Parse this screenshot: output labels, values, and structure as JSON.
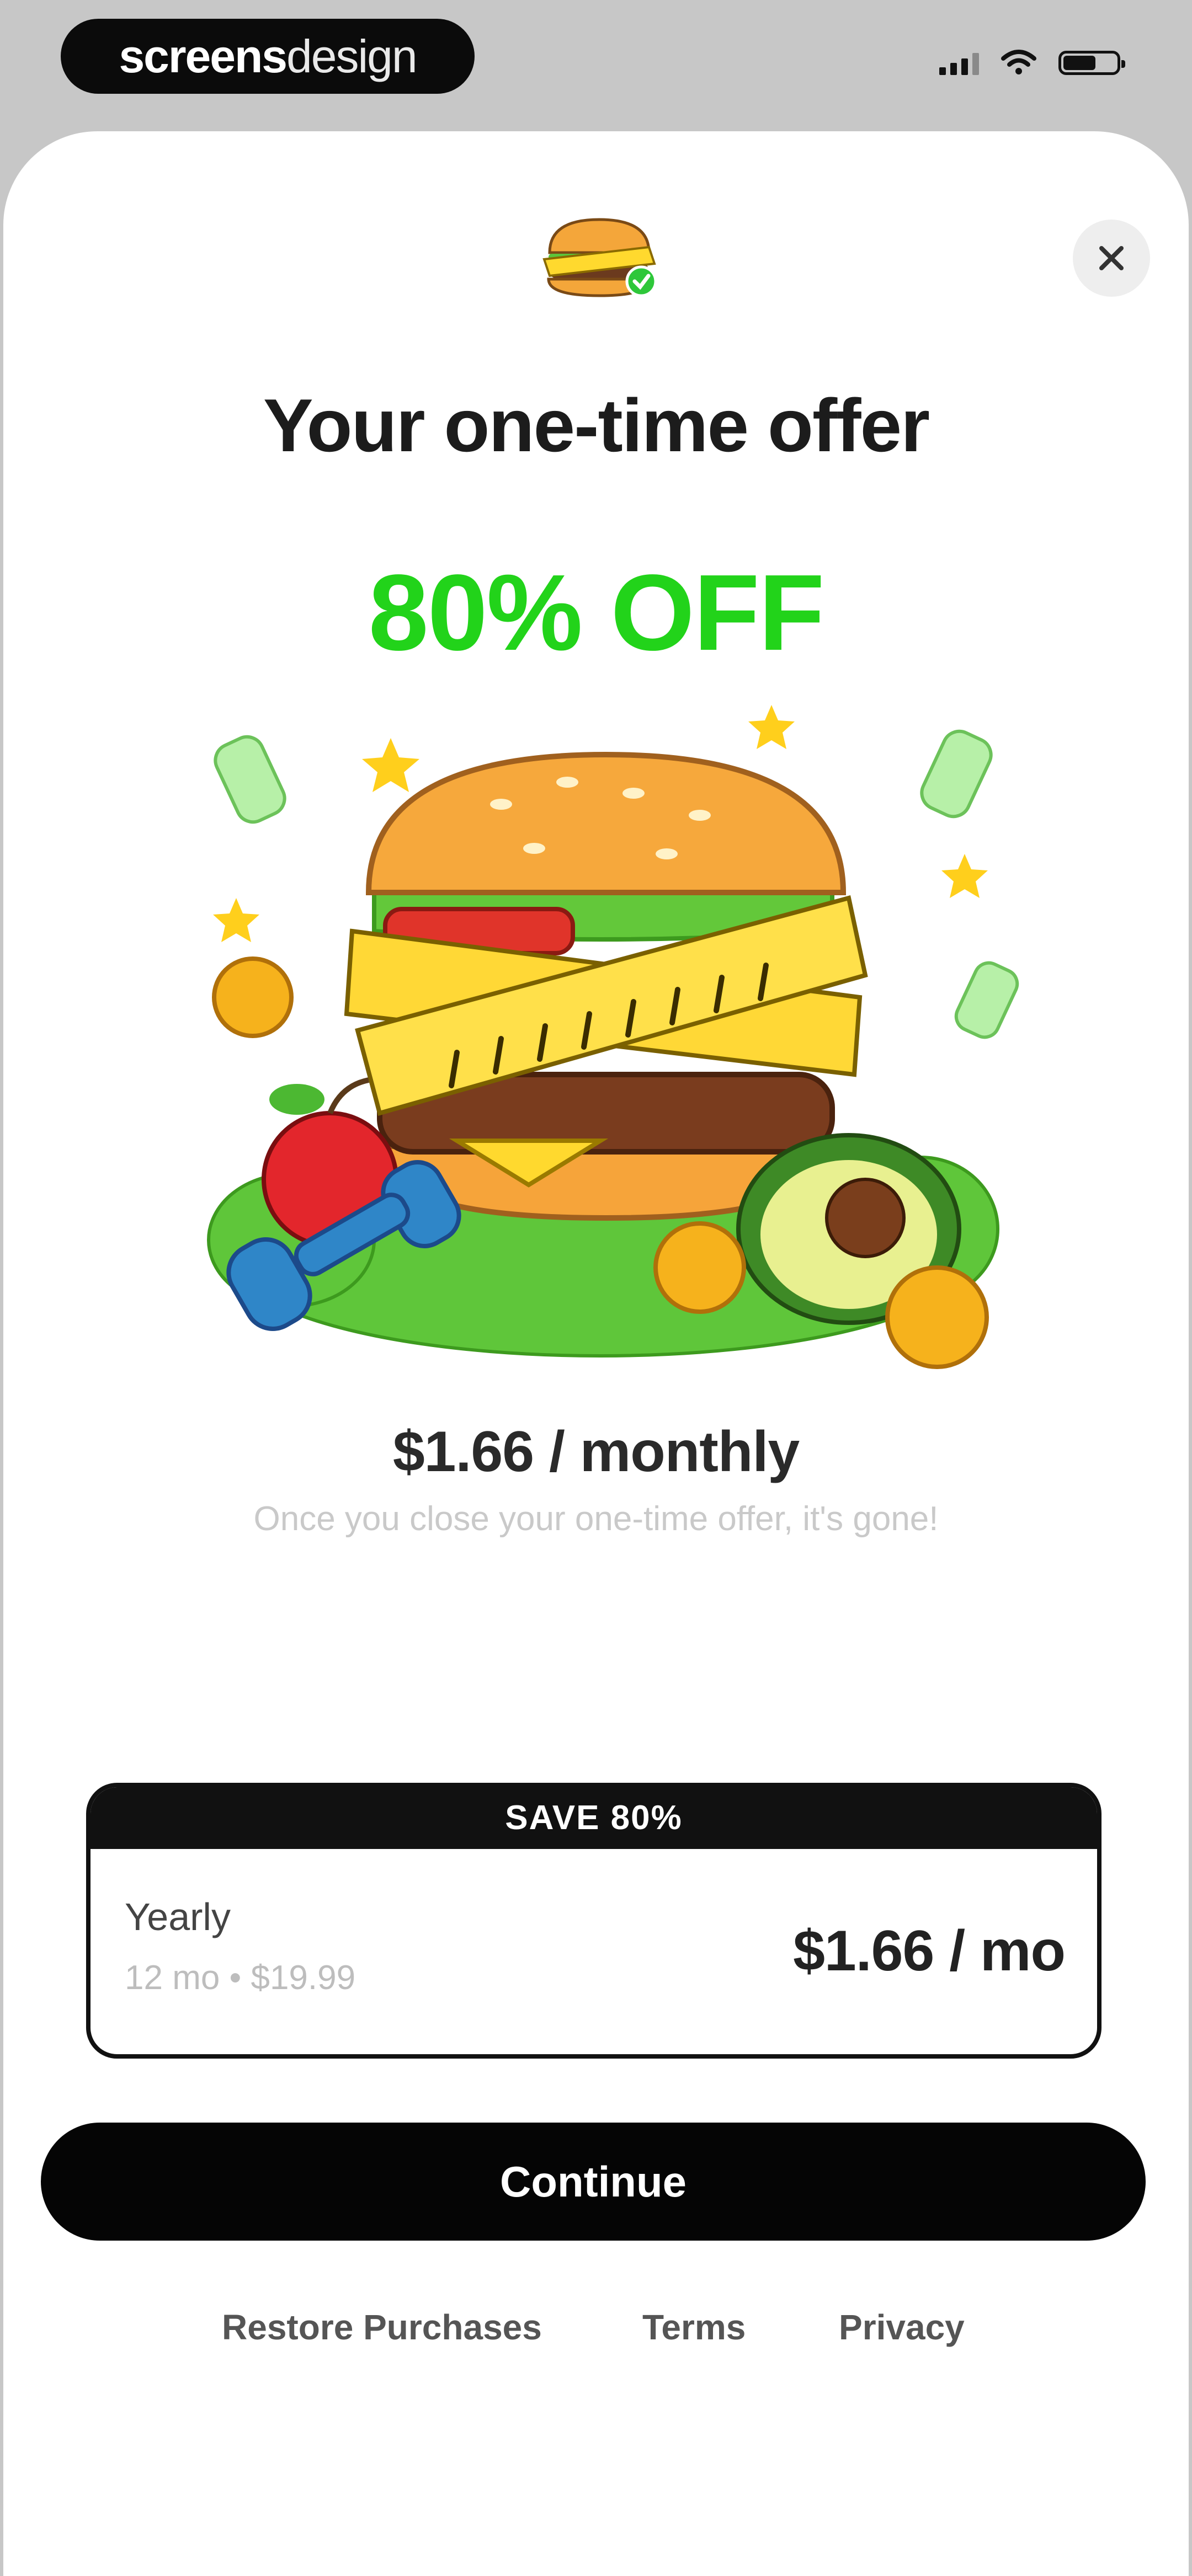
{
  "status_bar": {
    "brand_primary": "screens",
    "brand_secondary": "design",
    "signal_icon": "cellular-signal-icon",
    "wifi_icon": "wifi-icon",
    "battery_icon": "battery-icon"
  },
  "header": {
    "app_icon": "burger-tape-measure-icon",
    "close_icon": "close-icon"
  },
  "offer": {
    "title": "Your one-time offer",
    "discount": "80% OFF",
    "hero_image": "burger-with-measuring-tape-illustration",
    "price_monthly": "$1.66 / monthly",
    "note": "Once you close your one-time offer, it's gone!"
  },
  "plan": {
    "ribbon": "SAVE 80%",
    "name": "Yearly",
    "sub": "12 mo • $19.99",
    "price": "$1.66 / mo"
  },
  "actions": {
    "continue_label": "Continue"
  },
  "footer": {
    "restore": "Restore Purchases",
    "terms": "Terms",
    "privacy": "Privacy"
  },
  "colors": {
    "accent_green": "#22d31a",
    "button_black": "#050505",
    "sheet_bg": "#ffffff",
    "backdrop": "#c7c7c7"
  }
}
